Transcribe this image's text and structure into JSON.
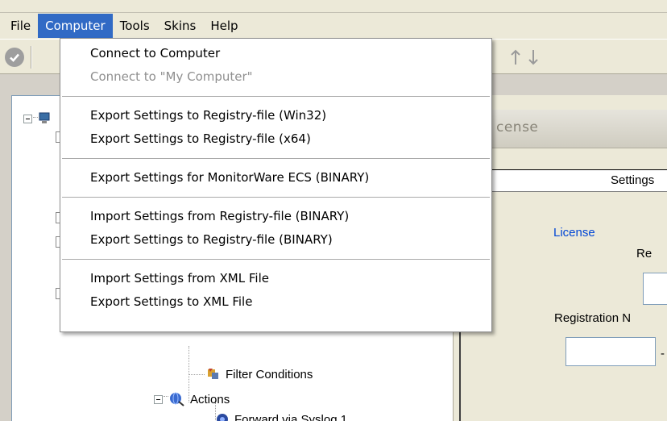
{
  "menubar": {
    "items": [
      {
        "label": "File"
      },
      {
        "label": "Computer"
      },
      {
        "label": "Tools"
      },
      {
        "label": "Skins"
      },
      {
        "label": "Help"
      }
    ],
    "active_index": 1
  },
  "dropdown": {
    "groups": [
      [
        {
          "label": "Connect to Computer",
          "enabled": true
        },
        {
          "label": "Connect to \"My Computer\"",
          "enabled": false
        }
      ],
      [
        {
          "label": "Export Settings to Registry-file (Win32)",
          "enabled": true
        },
        {
          "label": "Export Settings to Registry-file (x64)",
          "enabled": true
        }
      ],
      [
        {
          "label": "Export Settings for MonitorWare ECS (BINARY)",
          "enabled": true
        }
      ],
      [
        {
          "label": "Import Settings from Registry-file (BINARY)",
          "enabled": true
        },
        {
          "label": "Export Settings to Registry-file (BINARY)",
          "enabled": true
        }
      ],
      [
        {
          "label": "Import Settings from XML File",
          "enabled": true
        },
        {
          "label": "Export Settings to XML File",
          "enabled": true
        }
      ]
    ]
  },
  "tree": {
    "filter_conditions": "Filter Conditions",
    "actions": "Actions",
    "forward_item": "Forward via Syslog 1"
  },
  "right_pane": {
    "header": "cense",
    "tab": "Settings",
    "group_title": "License",
    "reg_label": "Re",
    "regnum_label": "Registration N",
    "dash": "-"
  },
  "colors": {
    "menu_highlight": "#316ac5",
    "group_title": "#0046d5",
    "chrome": "#ece9d8"
  },
  "icons": [
    "check-icon",
    "arrow-up-icon",
    "arrow-down-icon",
    "computer-icon",
    "filter-icon",
    "actions-globe-icon",
    "forward-icon"
  ]
}
